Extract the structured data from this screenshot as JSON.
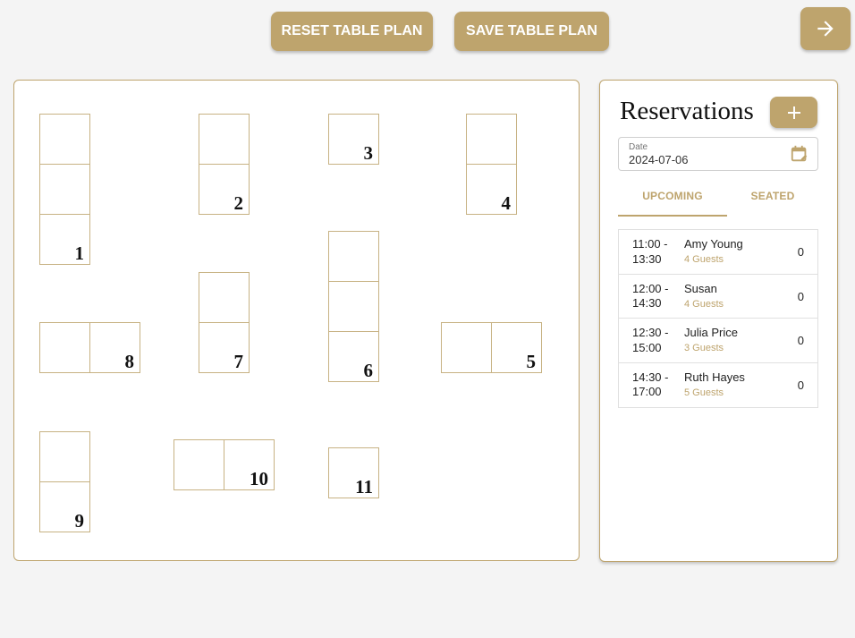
{
  "toolbar": {
    "reset_label": "RESET TABLE PLAN",
    "save_label": "SAVE TABLE PLAN",
    "next_icon": "arrow-right-icon"
  },
  "colors": {
    "accent": "#bea46d",
    "background": "#f4f4f4"
  },
  "floor_plan": {
    "tables": [
      {
        "number": "1",
        "seats": 3,
        "orientation": "vertical"
      },
      {
        "number": "2",
        "seats": 2,
        "orientation": "vertical"
      },
      {
        "number": "3",
        "seats": 1,
        "orientation": "single"
      },
      {
        "number": "4",
        "seats": 2,
        "orientation": "vertical"
      },
      {
        "number": "5",
        "seats": 2,
        "orientation": "horizontal"
      },
      {
        "number": "6",
        "seats": 3,
        "orientation": "vertical"
      },
      {
        "number": "7",
        "seats": 2,
        "orientation": "vertical"
      },
      {
        "number": "8",
        "seats": 2,
        "orientation": "horizontal"
      },
      {
        "number": "9",
        "seats": 2,
        "orientation": "vertical"
      },
      {
        "number": "10",
        "seats": 2,
        "orientation": "horizontal"
      },
      {
        "number": "11",
        "seats": 1,
        "orientation": "single"
      }
    ]
  },
  "reservations": {
    "title": "Reservations",
    "add_icon": "plus-icon",
    "date_label": "Date",
    "date_value": "2024-07-06",
    "calendar_icon": "calendar-edit-icon",
    "tabs": [
      {
        "label": "UPCOMING",
        "active": true
      },
      {
        "label": "SEATED",
        "active": false
      }
    ],
    "items": [
      {
        "time": "11:00 - 13:30",
        "name": "Amy Young",
        "guests": "4 Guests",
        "count": "0"
      },
      {
        "time": "12:00 - 14:30",
        "name": "Susan",
        "guests": "4 Guests",
        "count": "0"
      },
      {
        "time": "12:30 - 15:00",
        "name": "Julia Price",
        "guests": "3 Guests",
        "count": "0"
      },
      {
        "time": "14:30 - 17:00",
        "name": "Ruth Hayes",
        "guests": "5 Guests",
        "count": "0"
      }
    ]
  }
}
